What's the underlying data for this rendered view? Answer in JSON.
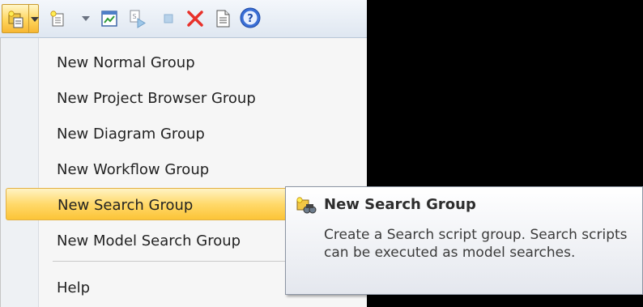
{
  "toolbar": {
    "icons": [
      "new-group-icon",
      "new-script-icon",
      "diagram-script-icon",
      "run-script-icon",
      "stop-icon",
      "delete-icon",
      "properties-icon",
      "help-icon"
    ]
  },
  "menu": {
    "items": [
      {
        "label": "New Normal Group"
      },
      {
        "label": "New Project Browser Group"
      },
      {
        "label": "New Diagram Group"
      },
      {
        "label": "New Workflow Group"
      },
      {
        "label": "New Search Group"
      },
      {
        "label": "New Model Search Group"
      },
      {
        "label": "Help"
      }
    ],
    "highlighted_index": 4
  },
  "tooltip": {
    "title": "New Search Group",
    "description": "Create a Search script group. Search scripts can be executed as model searches."
  },
  "colors": {
    "highlight": "#ffd96a",
    "delete_red": "#e8312a",
    "help_blue": "#3a6fd6"
  }
}
